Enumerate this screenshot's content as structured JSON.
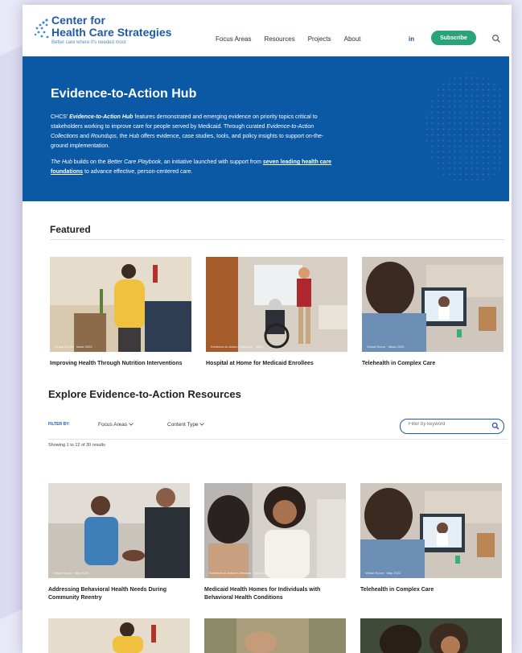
{
  "brand": {
    "name_line1": "Center for",
    "name_line2": "Health Care Strategies",
    "tagline": "Better care where it's needed most"
  },
  "nav": {
    "items": [
      "Focus Areas",
      "Resources",
      "Projects",
      "About"
    ],
    "active": "Resources",
    "social_label": "in",
    "subscribe_label": "Subscribe"
  },
  "hero": {
    "title": "Evidence-to-Action Hub",
    "p1_prefix": "CHCS'",
    "p1_hub": "Evidence-to-Action Hub",
    "p1_rest1": " features demonstrated and emerging evidence on priority topics critical to stakeholders working to improve care for people served by Medicaid. Through curated ",
    "p1_collections": "Evidence-to-Action Collections",
    "p1_and": " and ",
    "p1_roundups": "Roundups",
    "p1_rest2": ", the ",
    "p1_hub_short": "Hub",
    "p1_rest3": " offers evidence, case studies, tools, and policy insights to support on-the-ground implementation.",
    "p2_prefix": "The Hub",
    "p2_mid": " builds on the ",
    "p2_playbook": "Better Care Playbook",
    "p2_rest": ", an initiative launched with support from ",
    "p2_link": "seven leading health care foundations",
    "p2_end": " to advance effective, person-centered care."
  },
  "featured": {
    "title": "Featured",
    "cards": [
      {
        "title": "Improving Health Through Nutrition Interventions",
        "tag": "Virtual Room · Ideas 2023"
      },
      {
        "title": "Hospital at Home for Medicaid Enrollees",
        "tag": "Evidence-to-Action Collection · 2023"
      },
      {
        "title": "Telehealth in Complex Care",
        "tag": "Virtual Room · Ideas 2023"
      }
    ]
  },
  "explore": {
    "title": "Explore Evidence-to-Action Resources",
    "filter_label": "FILTER BY:",
    "focus_areas_label": "Focus Areas",
    "content_type_label": "Content Type",
    "search_placeholder": "Filter by keyword",
    "showing": "Showing 1 to 12 of 30 results",
    "cards": [
      {
        "title": "Addressing Behavioral Health Needs During Community Reentry",
        "tag": "Virtual Room · May 2023"
      },
      {
        "title": "Medicaid Health Homes for Individuals with Behavioral Health Conditions",
        "tag": "Evidence-to-Action Collection · June 2023"
      },
      {
        "title": "Telehealth in Complex Care",
        "tag": "Virtual Room · May 2023"
      }
    ]
  },
  "colors": {
    "hero_bg": "#0b58a5",
    "brand_blue": "#1f5aa6",
    "subscribe_green": "#2aa27a",
    "active_underline": "#f2a900"
  },
  "icons": [
    "logo-dots-icon",
    "search-icon",
    "linkedin-icon",
    "chevron-down-icon"
  ]
}
